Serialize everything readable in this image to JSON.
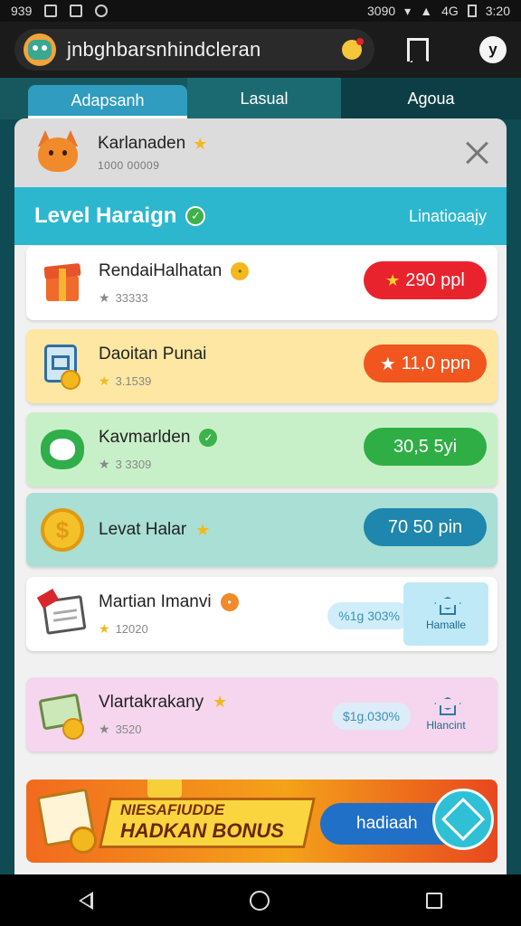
{
  "status_bar": {
    "left_text": "939",
    "right_text": "3090",
    "network": "4G",
    "time": "3:20"
  },
  "app_bar": {
    "search_text": "jnbghbarsnhindcleran",
    "icons": [
      "app-avatar-icon",
      "mic-icon",
      "bookmark-icon",
      "profile-icon"
    ],
    "profile_letter": "y"
  },
  "tabs": [
    {
      "label": "Adapsanh"
    },
    {
      "label": "Lasual"
    },
    {
      "label": "Agoua"
    }
  ],
  "header": {
    "title": "Karlanaden",
    "subtitle": "1000 00009"
  },
  "level": {
    "title": "Level Haraign",
    "link": "Linatioaajy"
  },
  "rows": [
    {
      "title": "RendaiHalhatan",
      "meta": "33333",
      "pill": "290 ppl",
      "icon": "gift-box-icon",
      "color": "#e8232e"
    },
    {
      "title": "Daoitan Punai",
      "meta": "3.1539",
      "pill": "11,0 ppn",
      "icon": "card-coin-icon",
      "color": "#f0561e"
    },
    {
      "title": "Kavmarlden",
      "meta": "3 3309",
      "pill": "30,5 5yi",
      "icon": "green-blob-icon",
      "color": "#2fae45"
    },
    {
      "title": "Levat Halar",
      "meta": "",
      "pill": "70 50 pin",
      "icon": "coin-icon",
      "color": "#1f86ad"
    },
    {
      "title": "Martian Imanvi",
      "meta": "12020",
      "side_pill": "%1g 303%",
      "side_label": "Hamalle",
      "icon": "document-icon"
    },
    {
      "title": "Vlartakrakany",
      "meta": "3520",
      "side_pill": "$1g.030%",
      "side_label": "Hlancint",
      "icon": "bill-coin-icon"
    }
  ],
  "bonus": {
    "line1": "NIESAFIUDDE",
    "line2": "HADKAN BONUS",
    "cta": "hadiaah"
  }
}
